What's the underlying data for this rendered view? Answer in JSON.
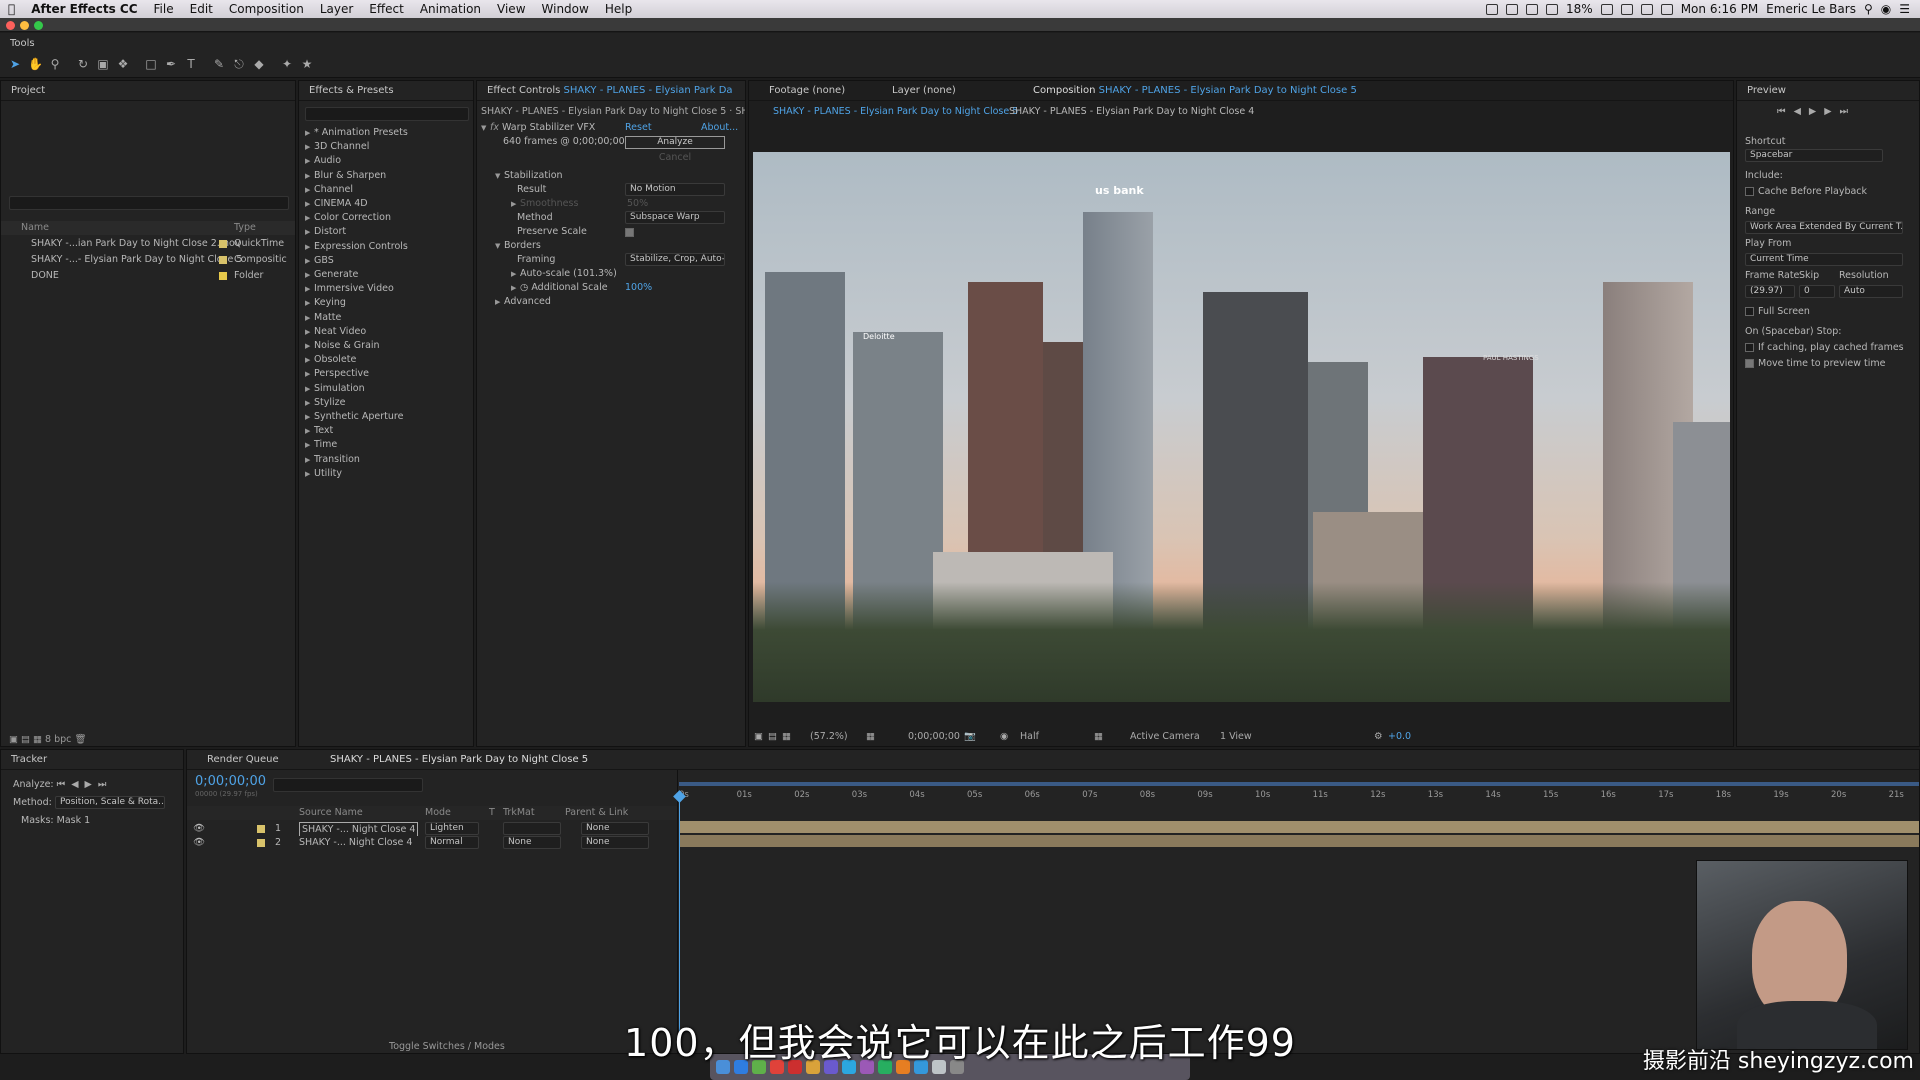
{
  "menubar": {
    "apple": "",
    "app_name": "After Effects CC",
    "items": [
      "File",
      "Edit",
      "Composition",
      "Layer",
      "Effect",
      "Animation",
      "View",
      "Window",
      "Help"
    ],
    "battery": "18%",
    "clock": "Mon 6:16 PM",
    "user": "Emeric Le Bars"
  },
  "tools": {
    "title": "Tools"
  },
  "project": {
    "title": "Project",
    "col_name": "Name",
    "col_type": "Type",
    "items": [
      {
        "name": "SHAKY -...ian Park Day to Night Close 2.mov",
        "type": "QuickTime",
        "color": "#d8c26a"
      },
      {
        "name": "SHAKY -...- Elysian Park Day to Night Close 5",
        "type": "Compositic",
        "color": "#d8c26a"
      },
      {
        "name": "DONE",
        "type": "Folder",
        "color": "#e6c84a"
      }
    ],
    "bpc": "8 bpc"
  },
  "effects": {
    "title": "Effects & Presets",
    "items": [
      "* Animation Presets",
      "3D Channel",
      "Audio",
      "Blur & Sharpen",
      "Channel",
      "CINEMA 4D",
      "Color Correction",
      "Distort",
      "Expression Controls",
      "GBS",
      "Generate",
      "Immersive Video",
      "Keying",
      "Matte",
      "Neat Video",
      "Noise & Grain",
      "Obsolete",
      "Perspective",
      "Simulation",
      "Stylize",
      "Synthetic Aperture",
      "Text",
      "Time",
      "Transition",
      "Utility"
    ]
  },
  "effect_controls": {
    "title_prefix": "Effect Controls",
    "title_comp": "SHAKY - PLANES - Elysian Park Da",
    "breadcrumb": "SHAKY - PLANES - Elysian Park Day to Night Close 5 · SHAKY - PL",
    "effect_name": "Warp Stabilizer VFX",
    "reset": "Reset",
    "about": "About...",
    "frames": "640 frames @ 0;00;00;00",
    "analyze": "Analyze",
    "cancel": "Cancel",
    "stabilization": "Stabilization",
    "result_label": "Result",
    "result_value": "No Motion",
    "smoothness_label": "Smoothness",
    "smoothness_value": "50%",
    "method_label": "Method",
    "method_value": "Subspace Warp",
    "preserve_label": "Preserve Scale",
    "borders": "Borders",
    "framing_label": "Framing",
    "framing_value": "Stabilize, Crop, Auto-",
    "autoscale_label": "Auto-scale (101.3%)",
    "addscale_label": "Additional Scale",
    "addscale_value": "100%",
    "advanced": "Advanced"
  },
  "comp_panel": {
    "tab_footage": "Footage (none)",
    "tab_layer": "Layer (none)",
    "tab_comp_prefix": "Composition",
    "tab_comp_name": "SHAKY - PLANES - Elysian Park Day to Night Close 5",
    "crumb_active": "SHAKY - PLANES - Elysian Park Day to Night Close 5",
    "crumb_other": "SHAKY - PLANES - Elysian Park Day to Night Close 4",
    "zoom": "(57.2%)",
    "time": "0;00;00;00",
    "resolution": "Half",
    "camera": "Active Camera",
    "views": "1 View",
    "exposure": "+0.0"
  },
  "preview": {
    "title": "Preview",
    "shortcut_label": "Shortcut",
    "shortcut_value": "Spacebar",
    "include_label": "Include:",
    "cache_label": "Cache Before Playback",
    "range_label": "Range",
    "range_value": "Work Area Extended By Current T...",
    "playfrom_label": "Play From",
    "playfrom_value": "Current Time",
    "framerate_label": "Frame Rate",
    "skip_label": "Skip",
    "resolution_label": "Resolution",
    "framerate_value": "(29.97)",
    "skip_value": "0",
    "resolution_value": "Auto",
    "fullscreen_label": "Full Screen",
    "stop_label": "On (Spacebar) Stop:",
    "ifcaching_label": "If caching, play cached frames",
    "movetime_label": "Move time to preview time"
  },
  "tracker": {
    "title": "Tracker",
    "analyze_label": "Analyze:",
    "method_label": "Method:",
    "method_value": "Position, Scale & Rota...",
    "masks_label": "Masks:",
    "masks_value": "Mask 1"
  },
  "timeline": {
    "render_queue": "Render Queue",
    "tab_name": "SHAKY - PLANES - Elysian Park Day to Night Close 5",
    "timecode": "0;00;00;00",
    "fps": "00000 (29.97 fps)",
    "col_source": "Source Name",
    "col_mode": "Mode",
    "col_t": "T",
    "col_trkmat": "TrkMat",
    "col_parent": "Parent & Link",
    "layers": [
      {
        "num": "1",
        "name": "SHAKY -... Night Close 4",
        "mode": "Lighten",
        "trkmat": "",
        "parent": "None"
      },
      {
        "num": "2",
        "name": "SHAKY -... Night Close 4",
        "mode": "Normal",
        "trkmat": "None",
        "parent": "None"
      }
    ],
    "ticks": [
      "0s",
      "01s",
      "02s",
      "03s",
      "04s",
      "05s",
      "06s",
      "07s",
      "08s",
      "09s",
      "10s",
      "11s",
      "12s",
      "13s",
      "14s",
      "15s",
      "16s",
      "17s",
      "18s",
      "19s",
      "20s",
      "21s"
    ],
    "toggle": "Toggle Switches / Modes"
  },
  "viewer": {
    "sign_bank": "us bank",
    "sign_deloitte": "Deloitte",
    "sign_paul": "PAUL HASTINGS"
  },
  "subtitle": "100，但我会说它可以在此之后工作99",
  "watermark": "摄影前沿 sheyingzyz.com"
}
